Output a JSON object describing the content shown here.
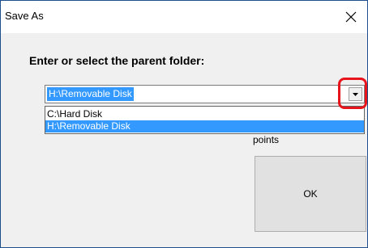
{
  "dialog": {
    "title": "Save As",
    "heading": "Enter or select the parent folder:",
    "combo": {
      "value": "H:\\Removable Disk"
    },
    "dropdown_options": [
      {
        "label": "C:\\Hard Disk",
        "selected": false
      },
      {
        "label": "H:\\Removable Disk",
        "selected": true
      }
    ],
    "partial_label": "points",
    "ok_label": "OK"
  },
  "colors": {
    "selection": "#3399ff",
    "highlight_ring": "#e8141c",
    "window_border": "#1f4e8c"
  },
  "icons": {
    "close": "close-icon",
    "dropdown": "dropdown-arrow-icon"
  }
}
